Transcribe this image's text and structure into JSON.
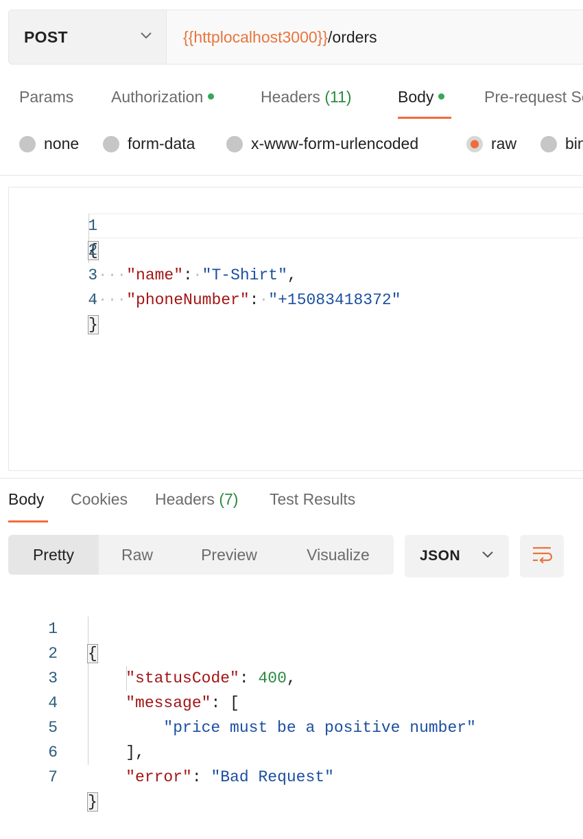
{
  "request": {
    "method": "POST",
    "url_variable": "{{httplocalhost3000}}",
    "url_path": "/orders"
  },
  "request_tabs": [
    {
      "label": "Params"
    },
    {
      "label": "Authorization"
    },
    {
      "label": "Headers",
      "count": "(11)"
    },
    {
      "label": "Body"
    },
    {
      "label": "Pre-request Script"
    }
  ],
  "body_types": [
    "none",
    "form-data",
    "x-www-form-urlencoded",
    "raw",
    "binary"
  ],
  "selected_body_type": "raw",
  "request_body": {
    "line_numbers": [
      "1",
      "2",
      "3",
      "4"
    ],
    "open_brace": "{",
    "close_brace": "}",
    "key1": "\"name\"",
    "val1": "\"T-Shirt\"",
    "key2": "\"phoneNumber\"",
    "val2": "\"+15083418372\""
  },
  "response_tabs": [
    {
      "label": "Body"
    },
    {
      "label": "Cookies"
    },
    {
      "label": "Headers",
      "count": "(7)"
    },
    {
      "label": "Test Results"
    }
  ],
  "view_modes": [
    "Pretty",
    "Raw",
    "Preview",
    "Visualize"
  ],
  "format": "JSON",
  "response_body": {
    "line_numbers": [
      "1",
      "2",
      "3",
      "4",
      "5",
      "6",
      "7"
    ],
    "open_brace": "{",
    "close_brace": "}",
    "key_status": "\"statusCode\"",
    "val_status": "400",
    "key_message": "\"message\"",
    "open_bracket": "[",
    "message_item": "\"price must be a positive number\"",
    "close_bracket": "],",
    "key_error": "\"error\"",
    "val_error": "\"Bad Request\""
  },
  "colors": {
    "accent": "#f26b3a",
    "variable": "#e9743c",
    "status_dot": "#34a853",
    "json_key": "#a31515",
    "json_string": "#1c4fa0",
    "json_number": "#2a8a3e",
    "line_number": "#2a5d7c"
  }
}
